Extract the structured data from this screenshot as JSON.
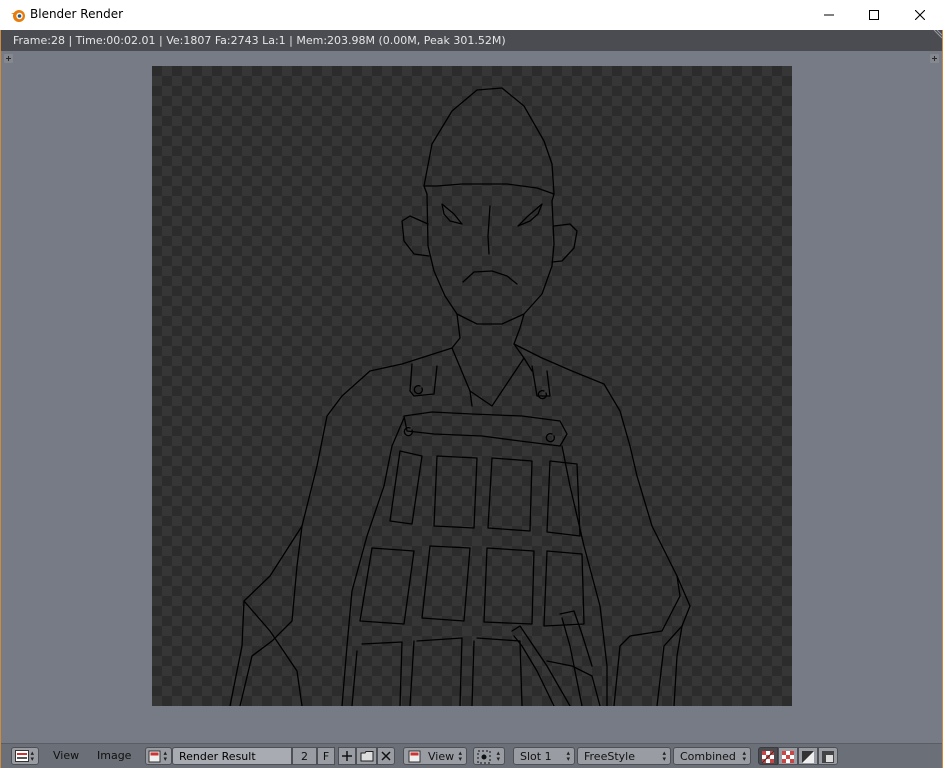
{
  "window": {
    "title": "Blender Render",
    "icon": "blender-logo-icon",
    "controls": [
      "minimize-icon",
      "maximize-icon",
      "close-icon"
    ]
  },
  "infobar": {
    "text": "Frame:28 | Time:00:02.01 | Ve:1807 Fa:2743 La:1 | Mem:203.98M (0.00M, Peak 301.52M)"
  },
  "footer": {
    "menu_view": "View",
    "menu_image": "Image",
    "image_name": "Render Result",
    "users_count": "2",
    "fake_user": "F",
    "view_dropdown": "View",
    "slot_dropdown": "Slot 1",
    "layer_dropdown": "FreeStyle",
    "pass_dropdown": "Combined"
  },
  "colors": {
    "background": "#767b85",
    "infobar": "#4a4c52",
    "accent_border": "#cf8a3c",
    "render_lines": "#000000"
  }
}
